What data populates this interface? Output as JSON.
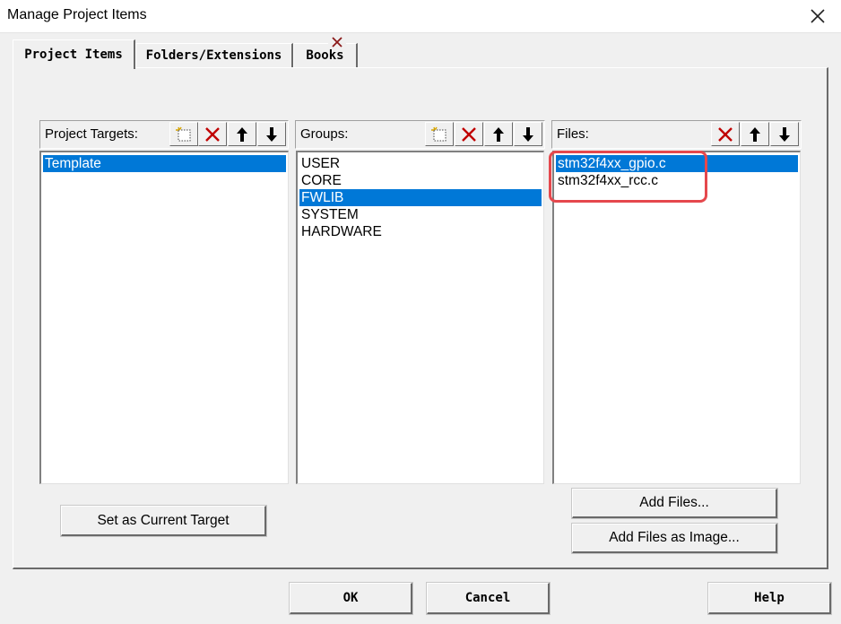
{
  "window": {
    "title": "Manage Project Items"
  },
  "tabs": [
    {
      "label": "Project Items",
      "active": true
    },
    {
      "label": "Folders/Extensions",
      "active": false
    },
    {
      "label": "Books",
      "active": false
    }
  ],
  "targets": {
    "label": "Project Targets:",
    "items": [
      {
        "label": "Template",
        "selected": true
      }
    ]
  },
  "groups": {
    "label": "Groups:",
    "items": [
      {
        "label": "USER",
        "selected": false
      },
      {
        "label": "CORE",
        "selected": false
      },
      {
        "label": "FWLIB",
        "selected": true
      },
      {
        "label": "SYSTEM",
        "selected": false
      },
      {
        "label": "HARDWARE",
        "selected": false
      }
    ]
  },
  "files": {
    "label": "Files:",
    "items": [
      {
        "label": "stm32f4xx_gpio.c",
        "selected": true
      },
      {
        "label": "stm32f4xx_rcc.c",
        "selected": false
      }
    ]
  },
  "buttons": {
    "set_current_target": "Set as Current Target",
    "add_files": "Add Files...",
    "add_files_image": "Add Files as Image...",
    "ok": "OK",
    "cancel": "Cancel",
    "help": "Help"
  },
  "colors": {
    "selection": "#0078d7",
    "highlight_box": "#e5484d",
    "delete_icon": "#c00000"
  }
}
